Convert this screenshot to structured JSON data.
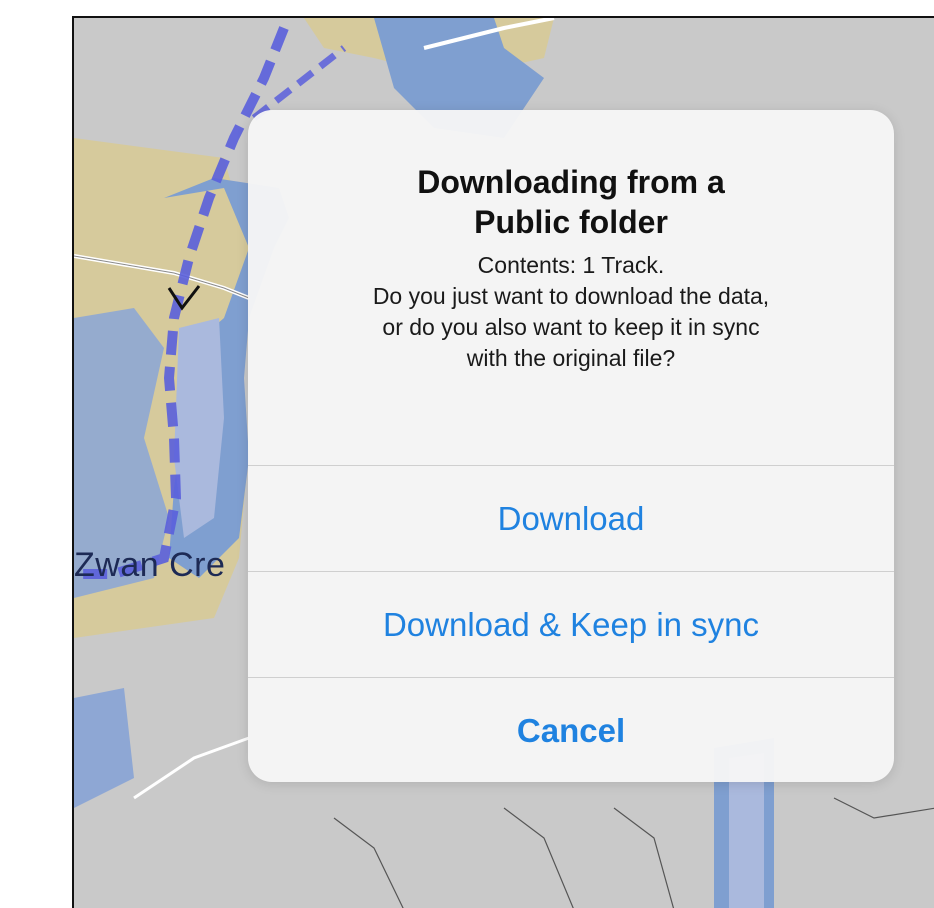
{
  "map": {
    "place_label": "Zwan Cre",
    "colors": {
      "land": "#c9c9c9",
      "shore": "#d6ca9c",
      "shallow": "#7f9fd0",
      "deep": "#aab9dd",
      "track": "#5a5fdc"
    }
  },
  "dialog": {
    "title_line1": "Downloading from a",
    "title_line2": "Public folder",
    "message_lines": [
      "Contents: 1 Track.",
      "Do you just want to download the data,",
      "or do you also want to keep it in sync",
      "with the original file?"
    ],
    "buttons": {
      "download": "Download",
      "download_sync": "Download & Keep in sync",
      "cancel": "Cancel"
    },
    "accent_color": "#1f82e0"
  }
}
